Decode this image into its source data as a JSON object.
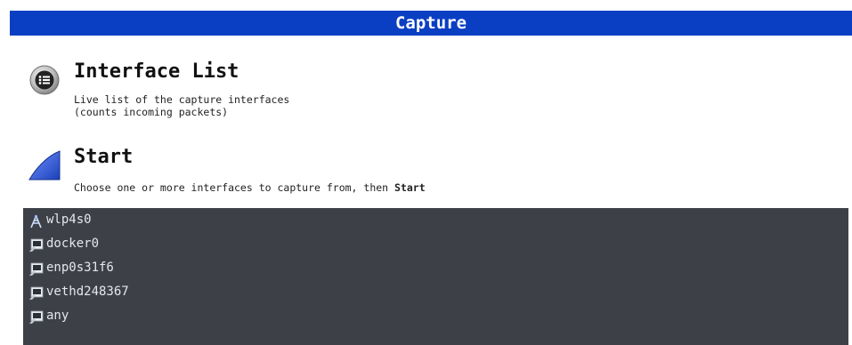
{
  "header": {
    "title": "Capture"
  },
  "interface_list": {
    "title": "Interface List",
    "desc_line1": "Live list of the capture interfaces",
    "desc_line2": "(counts incoming packets)",
    "icon": "list-icon"
  },
  "start": {
    "title": "Start",
    "desc_prefix": "Choose one or more interfaces to capture from, then ",
    "desc_bold": "Start",
    "icon": "shark-fin-icon"
  },
  "interfaces": [
    {
      "name": "wlp4s0",
      "icon": "wireless-icon"
    },
    {
      "name": "docker0",
      "icon": "network-interface-icon"
    },
    {
      "name": "enp0s31f6",
      "icon": "network-interface-icon"
    },
    {
      "name": "vethd248367",
      "icon": "network-interface-icon"
    },
    {
      "name": "any",
      "icon": "network-interface-icon"
    }
  ],
  "colors": {
    "header_bg": "#0b3fc3",
    "panel_bg": "#3d4047",
    "fin_blue": "#2b57d6"
  }
}
